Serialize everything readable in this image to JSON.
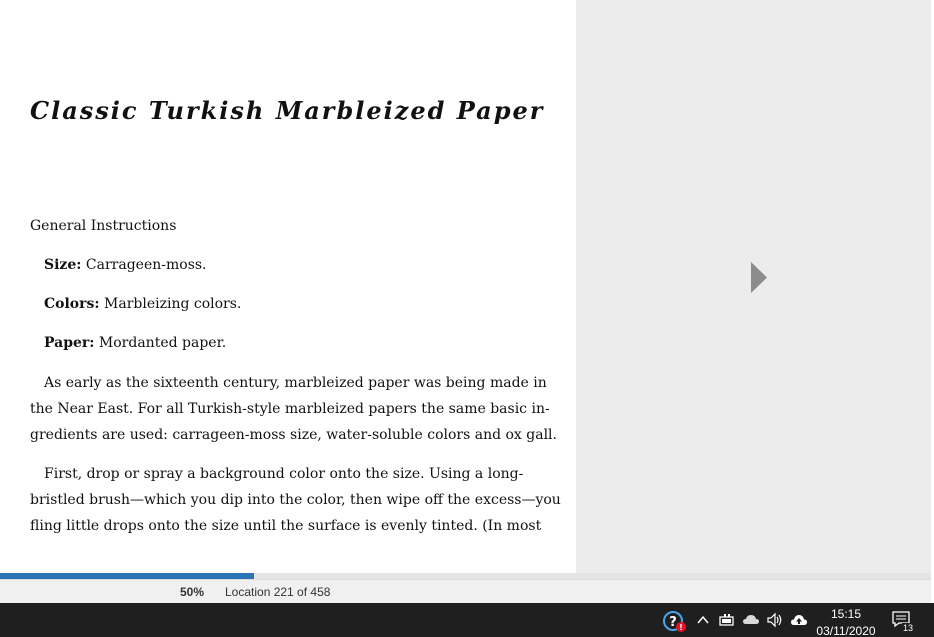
{
  "book": {
    "title": "Classic Turkish Marbleized Paper",
    "section_heading": "General Instructions",
    "specs": [
      {
        "label": "Size:",
        "value": " Carrageen-moss."
      },
      {
        "label": "Colors:",
        "value": " Marbleizing colors."
      },
      {
        "label": "Paper:",
        "value": " Mordanted paper."
      }
    ],
    "paragraph1": [
      "As early as the sixteenth century, marbleized paper was being made in",
      "the Near East. For all Turkish-style marbleized papers the same basic in-",
      "gredients are used: carrageen-moss size, water-soluble colors and ox gall."
    ],
    "paragraph2": [
      "First, drop or spray a background color onto the size. Using a long-",
      "bristled brush—which you dip into the color, then wipe off the excess—you",
      "fling little drops onto the size until the surface is evenly tinted. (In most"
    ]
  },
  "reader": {
    "progress_fraction": 0.273,
    "percent_label": "50%",
    "location_label": "Location 221 of 458",
    "next_page_icon": "triangle-right-icon"
  },
  "taskbar": {
    "time": "15:15",
    "date": "03/11/2020",
    "notification_count": "13",
    "icons": [
      "help-icon",
      "chevron-up-icon",
      "battery-icon",
      "onedrive-icon",
      "volume-icon",
      "cloud-upload-icon",
      "action-center-icon"
    ]
  },
  "colors": {
    "progress": "#2a73b5",
    "side_panel": "#ececec",
    "taskbar": "#1f1f1f",
    "help_badge": "#e81123"
  }
}
